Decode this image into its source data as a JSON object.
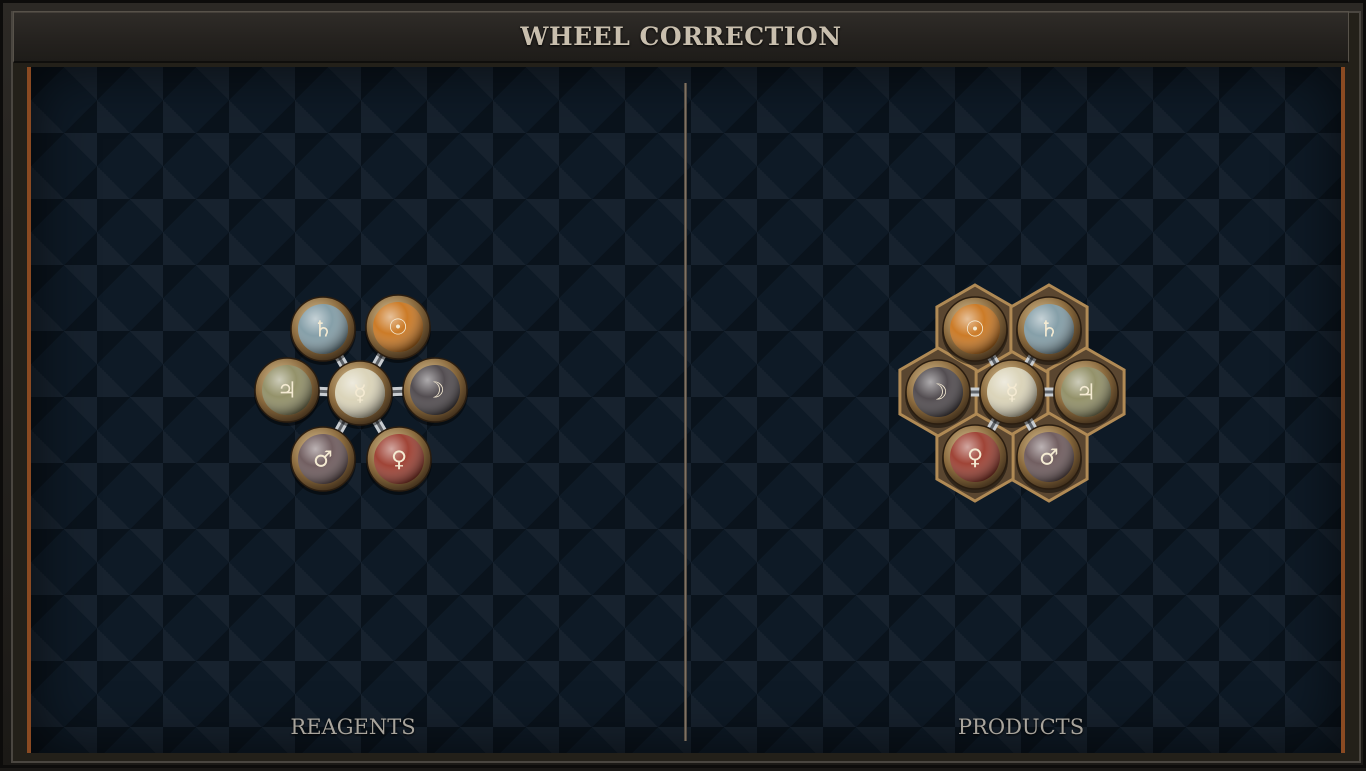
{
  "title": "WHEEL CORRECTION",
  "panels": {
    "reagents_label": "REAGENTS",
    "products_label": "PRODUCTS"
  },
  "reagents": {
    "atoms": [
      {
        "name": "quicksilver",
        "glyph": "☿",
        "color": "#d9d2b6"
      },
      {
        "name": "salt",
        "glyph": "♄",
        "color": "#7f9aa4"
      },
      {
        "name": "gold",
        "glyph": "☉",
        "color": "#c9741c"
      },
      {
        "name": "silver",
        "glyph": "☽",
        "color": "#4a4448"
      },
      {
        "name": "copper",
        "glyph": "♀",
        "color": "#9a3a2c"
      },
      {
        "name": "iron",
        "glyph": "♂",
        "color": "#6a5658"
      },
      {
        "name": "tin",
        "glyph": "♃",
        "color": "#8e8c62"
      }
    ]
  },
  "products": {
    "atoms": [
      {
        "name": "quicksilver",
        "glyph": "☿",
        "color": "#d9d2b6"
      },
      {
        "name": "gold",
        "glyph": "☉",
        "color": "#c9741c"
      },
      {
        "name": "salt",
        "glyph": "♄",
        "color": "#7f9aa4"
      },
      {
        "name": "tin",
        "glyph": "♃",
        "color": "#8e8c62"
      },
      {
        "name": "iron",
        "glyph": "♂",
        "color": "#6a5658"
      },
      {
        "name": "copper",
        "glyph": "♀",
        "color": "#9a3a2c"
      },
      {
        "name": "silver",
        "glyph": "☽",
        "color": "#4a4448"
      }
    ]
  }
}
